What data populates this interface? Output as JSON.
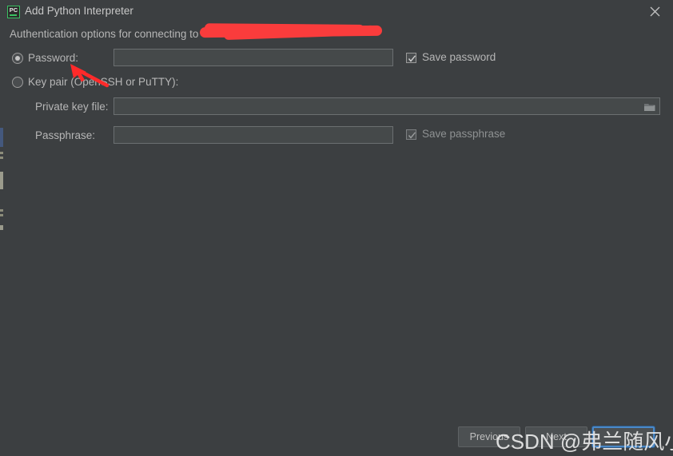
{
  "window": {
    "title": "Add Python Interpreter",
    "app_icon": "pycharm-icon",
    "icon_text": "PC",
    "close_icon": "close-icon",
    "accent_green": "#3ac162",
    "background": "#3c3f41"
  },
  "content": {
    "subtitle": "Authentication options for connecting to",
    "redacted_note": "host name covered by red redaction mark",
    "redaction_color": "#fa3c3c"
  },
  "auth_options": [
    {
      "id": "password",
      "label": "Password:",
      "selected": true,
      "field_value": "",
      "checkbox": {
        "label": "Save password",
        "checked": true,
        "disabled": false
      }
    },
    {
      "id": "key-pair",
      "label": "Key pair (OpenSSH or PuTTY):",
      "selected": false
    }
  ],
  "key_pair_fields": [
    {
      "id": "private-key-file",
      "label": "Private key file:",
      "value": "",
      "browse_icon": "folder-icon"
    },
    {
      "id": "passphrase",
      "label": "Passphrase:",
      "value": "",
      "checkbox": {
        "label": "Save passphrase",
        "checked": true,
        "disabled": true
      }
    }
  ],
  "footer": {
    "previous_label": "Previous",
    "next_label": "Next",
    "finish_label": "",
    "focused_button": "finish"
  },
  "annotations": {
    "arrow_color": "#ff2a2a",
    "arrow_target": "Password: radio option"
  },
  "watermark": {
    "text": "CSDN @弗兰随风小欢"
  }
}
